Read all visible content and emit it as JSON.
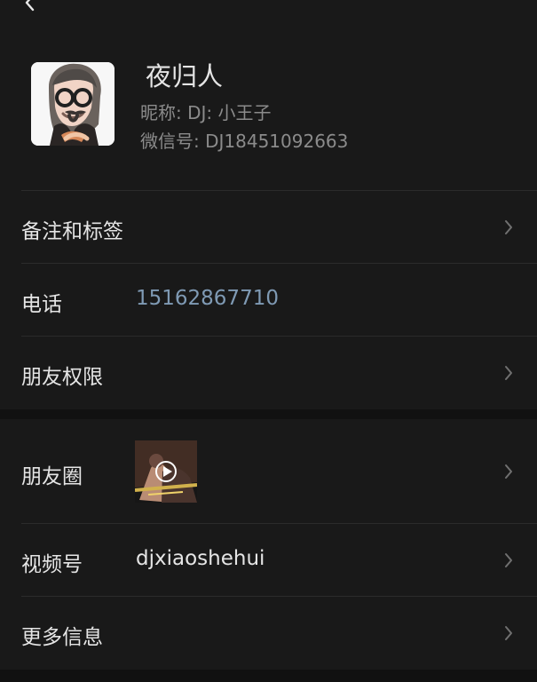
{
  "header": {
    "back_icon": "chevron-left-icon"
  },
  "profile": {
    "name": "夜归人",
    "nickname_text": "昵称: DJ: 小王子",
    "wechat_id_text": "微信号: DJ18451092663",
    "avatar_icon": "cartoon-avatar-icon"
  },
  "rows": {
    "notes_tags": {
      "label": "备注和标签"
    },
    "phone": {
      "label": "电话",
      "value": "15162867710"
    },
    "friend_permissions": {
      "label": "朋友权限"
    },
    "moments": {
      "label": "朋友圈",
      "thumbnail_icon": "video-thumbnail-icon"
    },
    "channels": {
      "label": "视频号",
      "value": "djxiaoshehui"
    },
    "more_info": {
      "label": "更多信息"
    }
  },
  "colors": {
    "background": "#111111",
    "card": "#191919",
    "phone_link": "#7f9ab4",
    "primary_text": "#e5e5e5",
    "secondary_text": "#8b8b8b",
    "chevron": "#6f6f6f"
  }
}
